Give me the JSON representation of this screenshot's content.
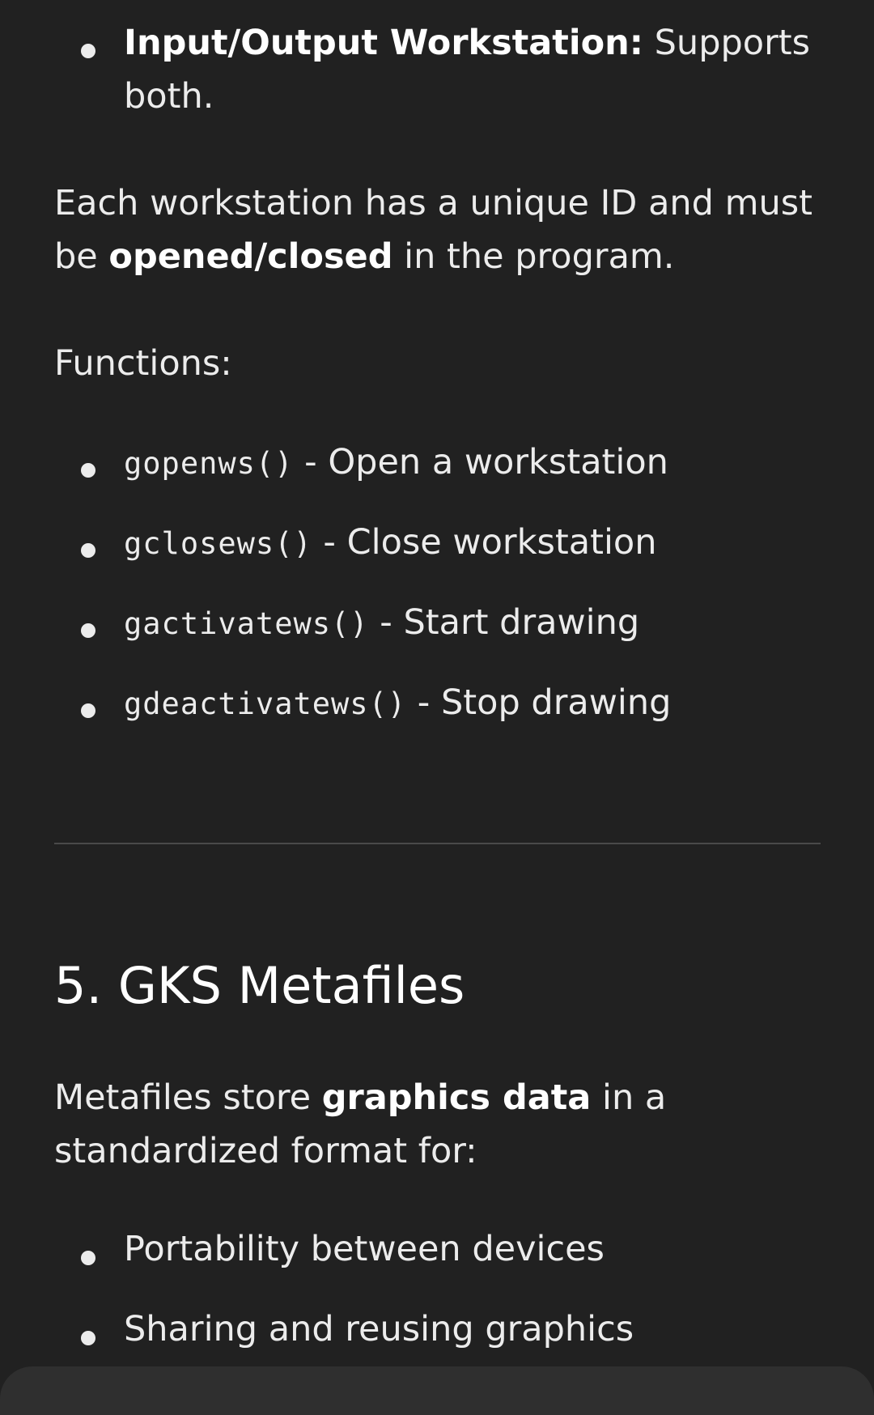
{
  "io_item": {
    "label": "Input/Output Workstation:",
    "text_line1": "Supports",
    "text_line2": "both."
  },
  "workstation_para": {
    "line1": "Each workstation has a unique ID and must",
    "line2_pre": "be ",
    "line2_strong": "opened/closed",
    "line2_post": " in the program."
  },
  "functions_label": "Functions:",
  "functions": [
    {
      "code": "gopenws()",
      "desc": " - Open a workstation"
    },
    {
      "code": "gclosews()",
      "desc": " - Close workstation"
    },
    {
      "code": "gactivatews()",
      "desc": " - Start drawing"
    },
    {
      "code": "gdeactivatews()",
      "desc": " - Stop drawing"
    }
  ],
  "section_heading": "5. GKS Metafiles",
  "metafiles_para": {
    "line1_pre": "Metafiles store ",
    "line1_strong": "graphics data",
    "line1_post": " in a",
    "line2": "standardized format for:"
  },
  "metafile_uses": [
    "Portability between devices",
    "Sharing and reusing graphics"
  ]
}
